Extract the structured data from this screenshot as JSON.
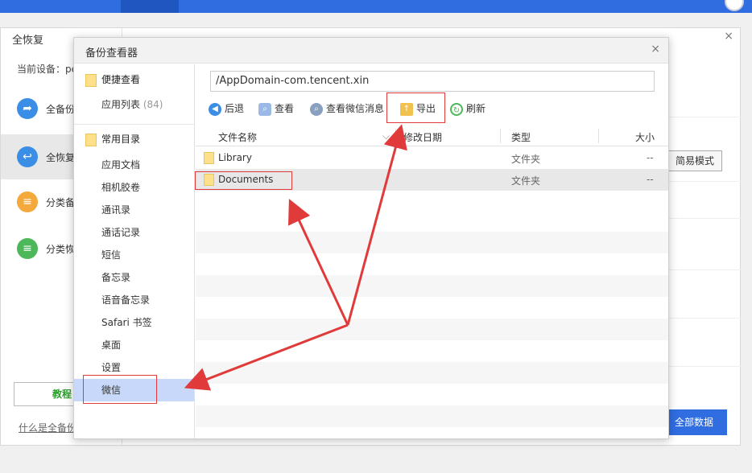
{
  "background_window": {
    "title": "全恢复",
    "device_label": "当前设备：pe",
    "side_items": [
      {
        "label": "全备份",
        "icon": "backup-arrow-icon",
        "color": "#3a8ee6"
      },
      {
        "label": "全恢复",
        "icon": "restore-arrow-icon",
        "color": "#3a8ee6"
      },
      {
        "label": "分类备",
        "icon": "category-backup-icon",
        "color": "#f3a93b"
      },
      {
        "label": "分类恢",
        "icon": "category-restore-icon",
        "color": "#4cb85a"
      }
    ],
    "tutorial_label": "教程",
    "what_is_link": "什么是全备份",
    "simple_mode_label": "简易模式",
    "all_data_label": "全部数据"
  },
  "dialog": {
    "title": "备份查看器",
    "close_glyph": "×",
    "left": {
      "group1_label": "便捷查看",
      "app_list_label": "应用列表",
      "app_list_count": "(84)",
      "group2_label": "常用目录",
      "items": [
        "应用文档",
        "相机胶卷",
        "通讯录",
        "通话记录",
        "短信",
        "备忘录",
        "语音备忘录",
        "Safari 书签",
        "桌面",
        "设置",
        "微信"
      ],
      "selected_item": "微信"
    },
    "path": "/AppDomain-com.tencent.xin",
    "toolbar": {
      "back_label": "后退",
      "view_label": "查看",
      "view_wechat_label": "查看微信消息",
      "export_label": "导出",
      "refresh_label": "刷新"
    },
    "columns": {
      "name": "文件名称",
      "modified": "修改日期",
      "type": "类型",
      "size": "大小"
    },
    "rows": [
      {
        "name": "Library",
        "type": "文件夹",
        "size": "--"
      },
      {
        "name": "Documents",
        "type": "文件夹",
        "size": "--"
      }
    ]
  },
  "colors": {
    "accent": "#2f6de0",
    "selection": "#c7d8fb",
    "annotation_red": "#e03a3a"
  }
}
